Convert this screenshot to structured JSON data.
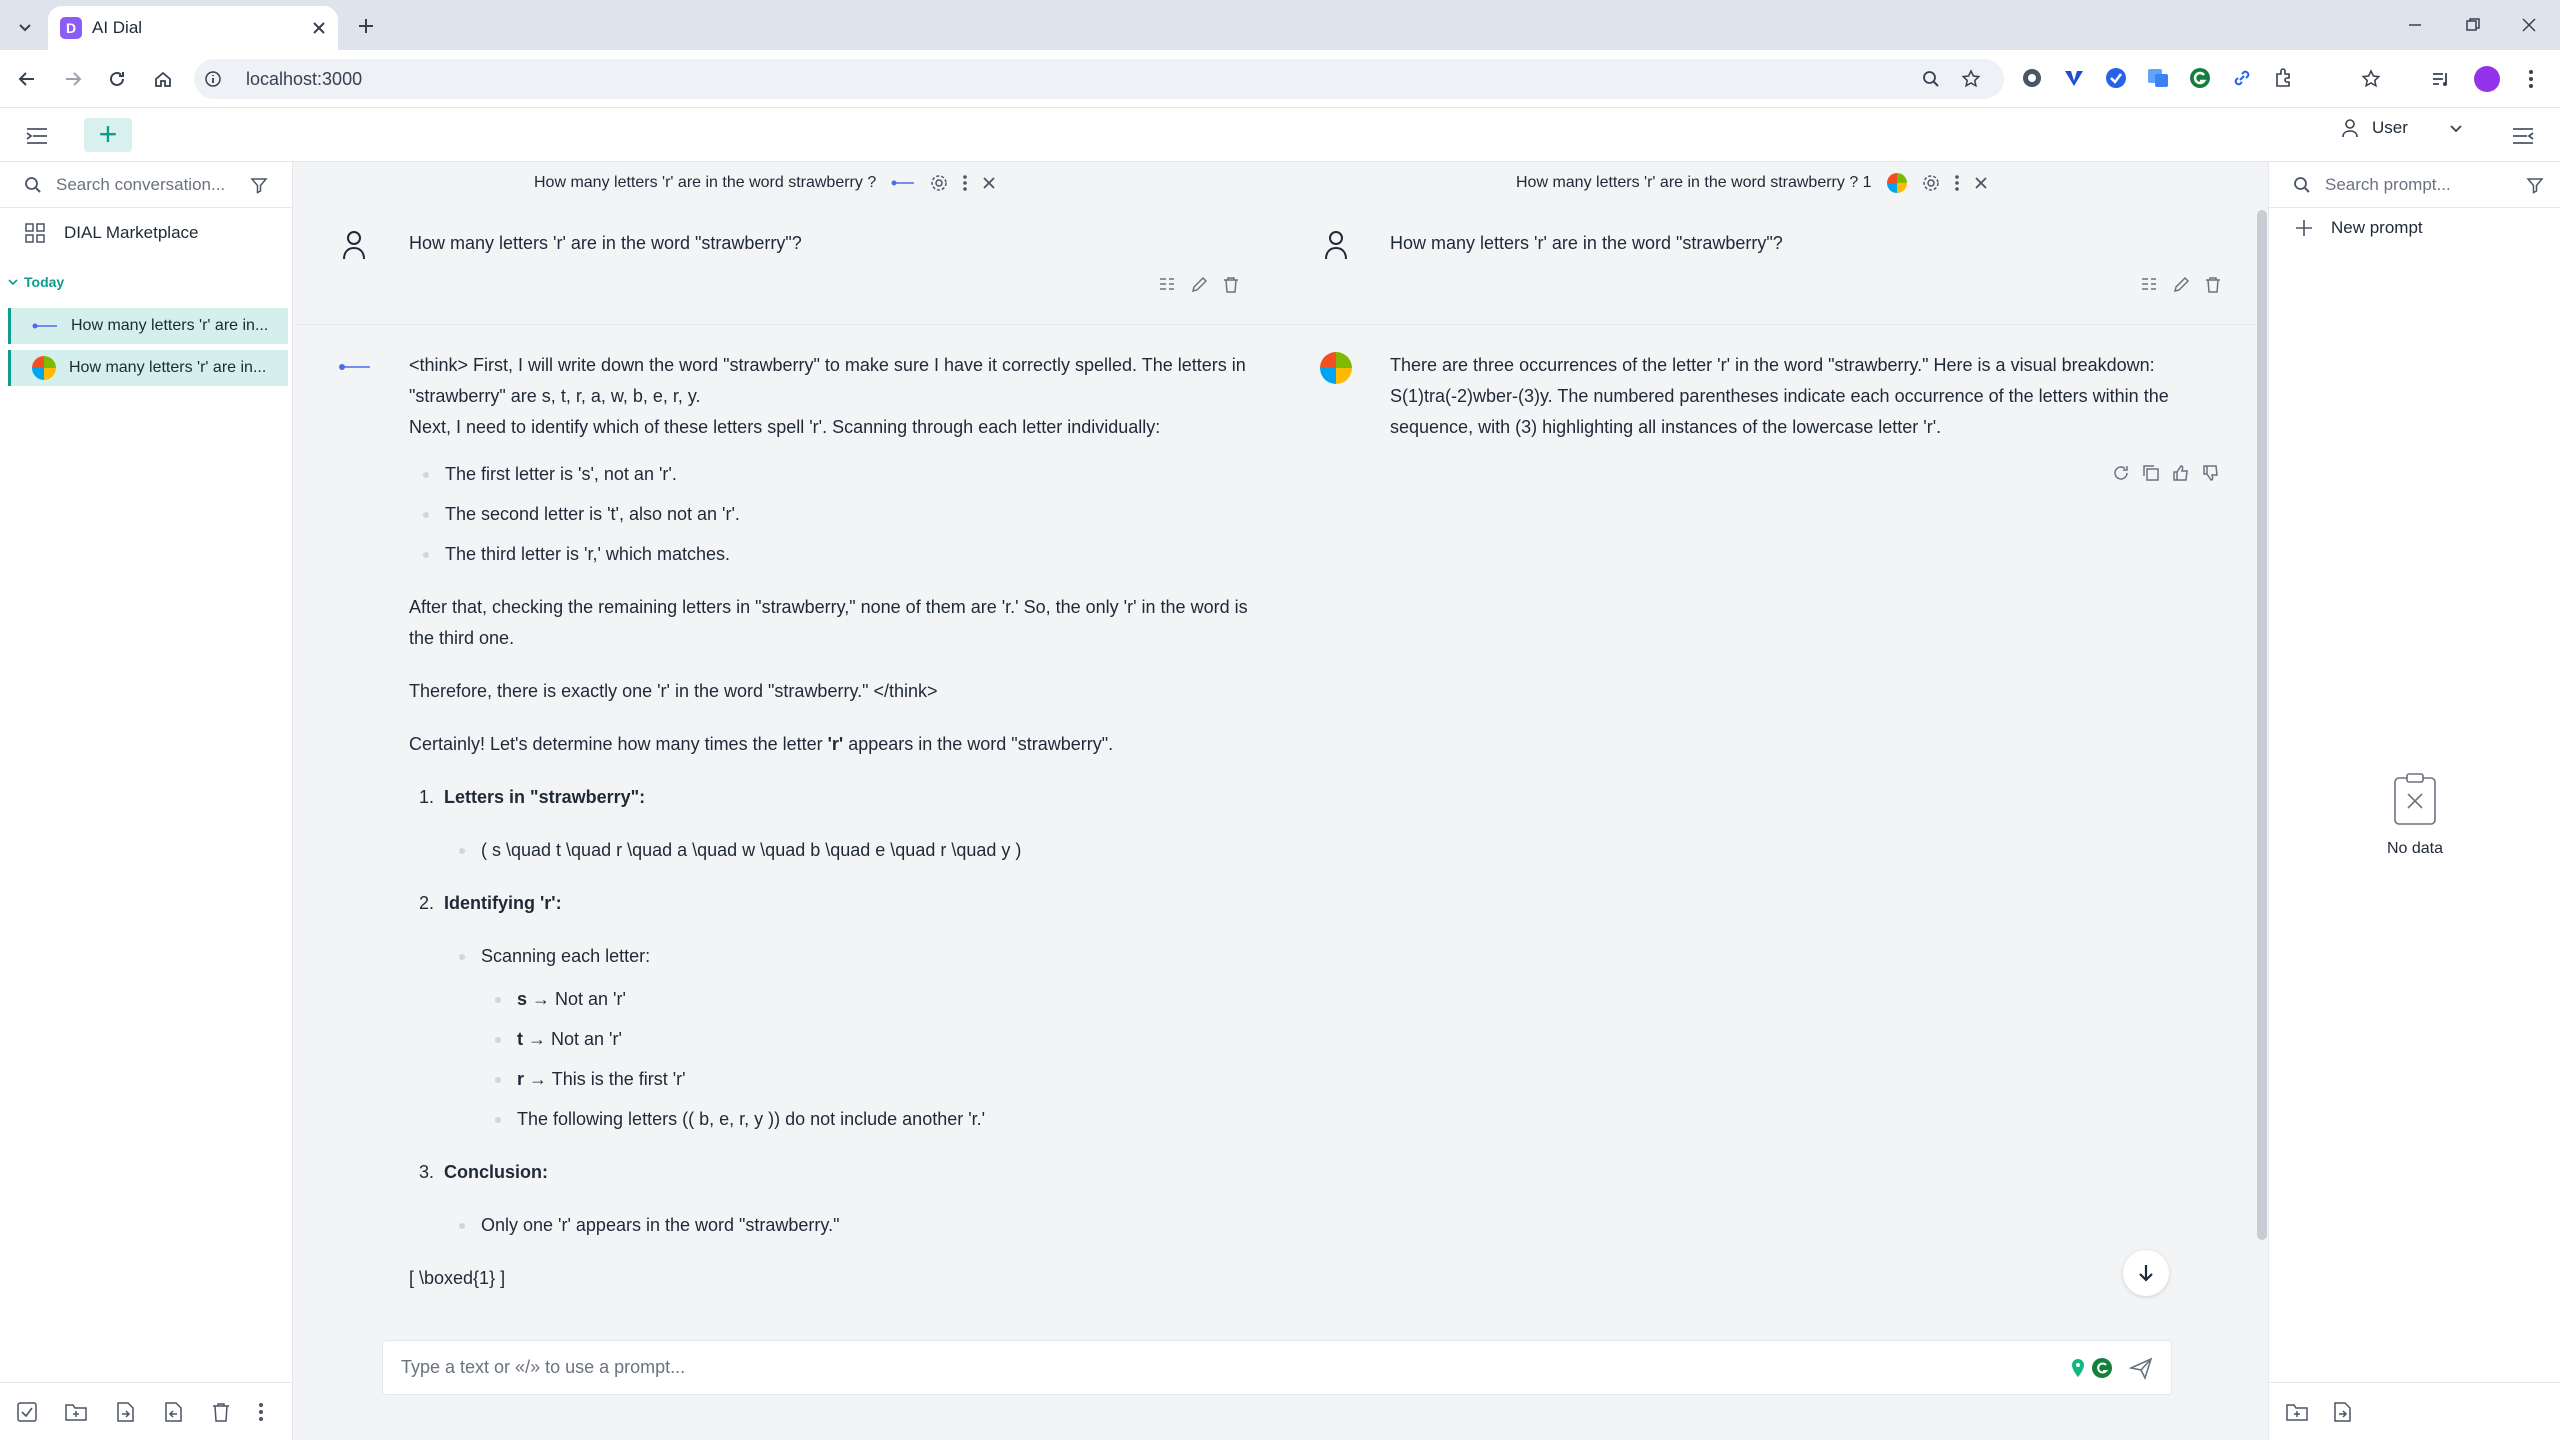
{
  "browser": {
    "tab_title": "AI Dial",
    "tab_favicon": "D",
    "url": "localhost:3000"
  },
  "app": {
    "user_label": "User"
  },
  "left_sidebar": {
    "search_placeholder": "Search conversation...",
    "marketplace_label": "DIAL Marketplace",
    "section_today": "Today",
    "conversations": [
      {
        "label": "How many letters 'r' are in..."
      },
      {
        "label": "How many letters 'r' are in..."
      }
    ]
  },
  "right_sidebar": {
    "search_placeholder": "Search prompt...",
    "new_prompt_label": "New prompt",
    "empty_label": "No data"
  },
  "chat_left": {
    "header_title": "How many letters 'r' are in the word  strawberry ?",
    "user_message": "How many letters 'r' are in the word \"strawberry\"?",
    "answer": {
      "p1": "<think> First, I will write down the word \"strawberry\" to make sure I have it correctly spelled. The letters in \"strawberry\" are s, t, r, a, w, b, e, r, y.",
      "p2": "Next, I need to identify which of these letters spell 'r'. Scanning through each letter individually:",
      "bullets": [
        "The first letter is 's', not an 'r'.",
        "The second letter is 't', also not an 'r'.",
        "The third letter is 'r,' which matches."
      ],
      "p3": "After that, checking the remaining letters in \"strawberry,\" none of them are 'r.' So, the only 'r' in the word is the third one.",
      "p4": "Therefore, there is exactly one 'r' in the word \"strawberry.\" </think>",
      "p5_a": "Certainly! Let's determine how many times the letter ",
      "p5_b": "'r'",
      "p5_c": " appears in the word \"strawberry\".",
      "n1_num": "1.",
      "n1_title": "Letters in \"strawberry\":",
      "n1_item": "( s \\quad t \\quad r \\quad a \\quad w \\quad b \\quad e \\quad r \\quad y )",
      "n2_num": "2.",
      "n2_title": "Identifying 'r':",
      "n2_item": "Scanning each letter:",
      "n2_sub": [
        {
          "bold": "s",
          "rest": " → Not an 'r'"
        },
        {
          "bold": "t",
          "rest": " → Not an 'r'"
        },
        {
          "bold": "r",
          "rest": " → This is the first 'r'"
        }
      ],
      "n2_sub_last": "The following letters (( b, e, r, y )) do not include another 'r.'",
      "n3_num": "3.",
      "n3_title": "Conclusion:",
      "n3_item": "Only one 'r' appears in the word \"strawberry.\"",
      "final": "[ \\boxed{1} ]"
    }
  },
  "chat_right": {
    "header_title": "How many letters 'r' are in the word  strawberry ? 1",
    "user_message": "How many letters 'r' are in the word \"strawberry\"?",
    "answer": "There are three occurrences of the letter 'r' in the word \"strawberry.\" Here is a visual breakdown: S(1)tra(-2)wber-(3)y. The numbered parentheses indicate each occurrence of the letters within the sequence, with (3) highlighting all instances of the lowercase letter 'r'."
  },
  "input": {
    "placeholder": "Type a text or «/» to use a prompt..."
  },
  "colors": {
    "accent": "#0f9b8e",
    "selected_bg": "#d4efec",
    "tab_favicon": "#8b5cf6"
  }
}
